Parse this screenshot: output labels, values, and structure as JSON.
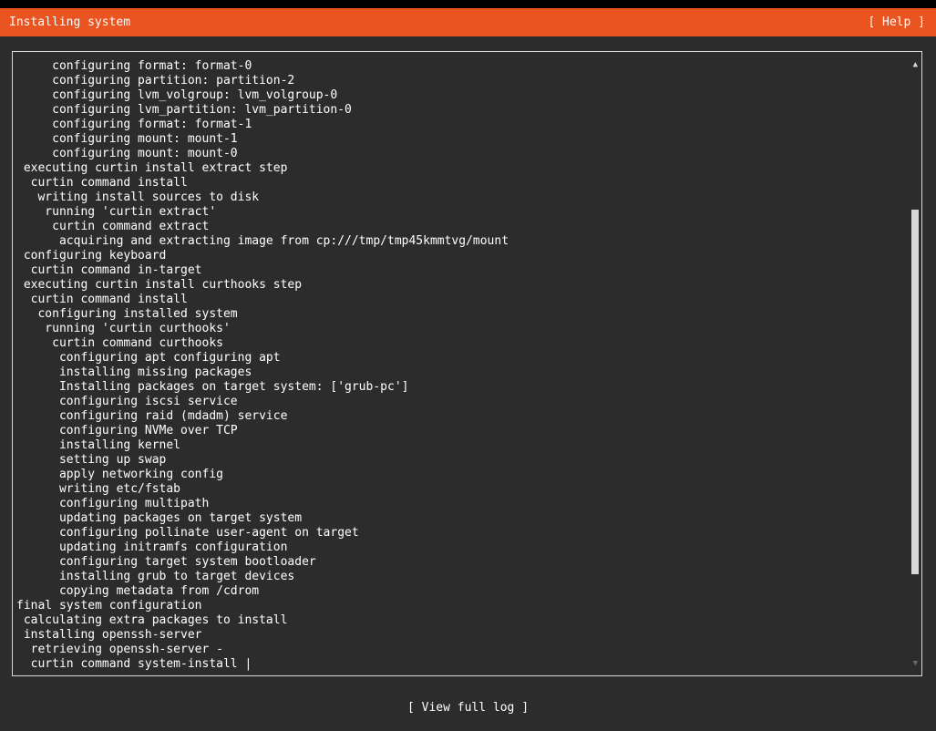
{
  "header": {
    "title": "Installing system",
    "help_label": "[ Help ]"
  },
  "log": {
    "lines": [
      "     configuring format: format-0",
      "     configuring partition: partition-2",
      "     configuring lvm_volgroup: lvm_volgroup-0",
      "     configuring lvm_partition: lvm_partition-0",
      "     configuring format: format-1",
      "     configuring mount: mount-1",
      "     configuring mount: mount-0",
      " executing curtin install extract step",
      "  curtin command install",
      "   writing install sources to disk",
      "    running 'curtin extract'",
      "     curtin command extract",
      "      acquiring and extracting image from cp:///tmp/tmp45kmmtvg/mount",
      " configuring keyboard",
      "  curtin command in-target",
      " executing curtin install curthooks step",
      "  curtin command install",
      "   configuring installed system",
      "    running 'curtin curthooks'",
      "     curtin command curthooks",
      "      configuring apt configuring apt",
      "      installing missing packages",
      "      Installing packages on target system: ['grub-pc']",
      "      configuring iscsi service",
      "      configuring raid (mdadm) service",
      "      configuring NVMe over TCP",
      "      installing kernel",
      "      setting up swap",
      "      apply networking config",
      "      writing etc/fstab",
      "      configuring multipath",
      "      updating packages on target system",
      "      configuring pollinate user-agent on target",
      "      updating initramfs configuration",
      "      configuring target system bootloader",
      "      installing grub to target devices",
      "      copying metadata from /cdrom",
      "final system configuration",
      " calculating extra packages to install",
      " installing openssh-server",
      "  retrieving openssh-server -",
      "  curtin command system-install |"
    ],
    "scroll_position": 0.62
  },
  "footer": {
    "view_log_label": "[ View full log ]"
  },
  "colors": {
    "header_bg": "#e95420",
    "screen_bg": "#2c2c2c",
    "text": "#ffffff",
    "frame_border": "#d8d8d8"
  },
  "icons": {
    "scroll_up": "scroll-up-arrow-icon",
    "scroll_down": "scroll-down-arrow-icon"
  }
}
